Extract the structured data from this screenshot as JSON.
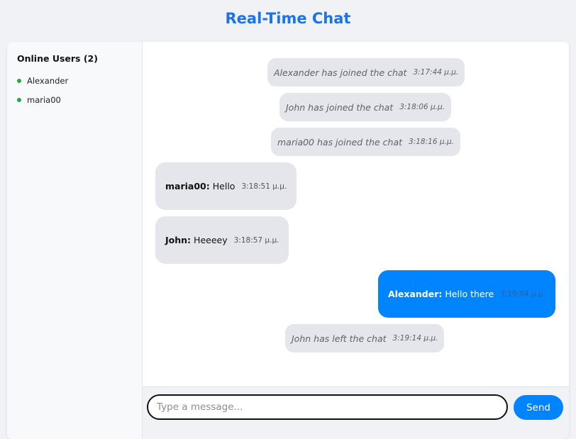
{
  "header": {
    "title": "Real-Time Chat"
  },
  "sidebar": {
    "title": "Online Users (2)",
    "users": [
      {
        "name": "Alexander",
        "status": "online"
      },
      {
        "name": "maria00",
        "status": "online"
      }
    ]
  },
  "messages": [
    {
      "type": "system",
      "text": "Alexander has joined the chat",
      "time": "3:17:44 μ.μ."
    },
    {
      "type": "system",
      "text": "John has joined the chat",
      "time": "3:18:06 μ.μ."
    },
    {
      "type": "system",
      "text": "maria00 has joined the chat",
      "time": "3:18:16 μ.μ."
    },
    {
      "type": "other",
      "sender": "maria00:",
      "text": "Hello",
      "time": "3:18:51 μ.μ."
    },
    {
      "type": "other",
      "sender": "John:",
      "text": "Heeeey",
      "time": "3:18:57 μ.μ."
    },
    {
      "type": "self",
      "sender": "Alexander:",
      "text": "Hello there",
      "time": "3:19:04 μ.μ."
    },
    {
      "type": "system",
      "text": "John has left the chat",
      "time": "3:19:14 μ.μ."
    }
  ],
  "input": {
    "placeholder": "Type a message...",
    "value": ""
  },
  "send": {
    "label": "Send"
  },
  "colors": {
    "title": "#1a73e8",
    "self_bubble": "#0084ff",
    "other_bubble": "#e4e6eb",
    "online_dot": "#28a745",
    "send_button": "#0084ff"
  }
}
